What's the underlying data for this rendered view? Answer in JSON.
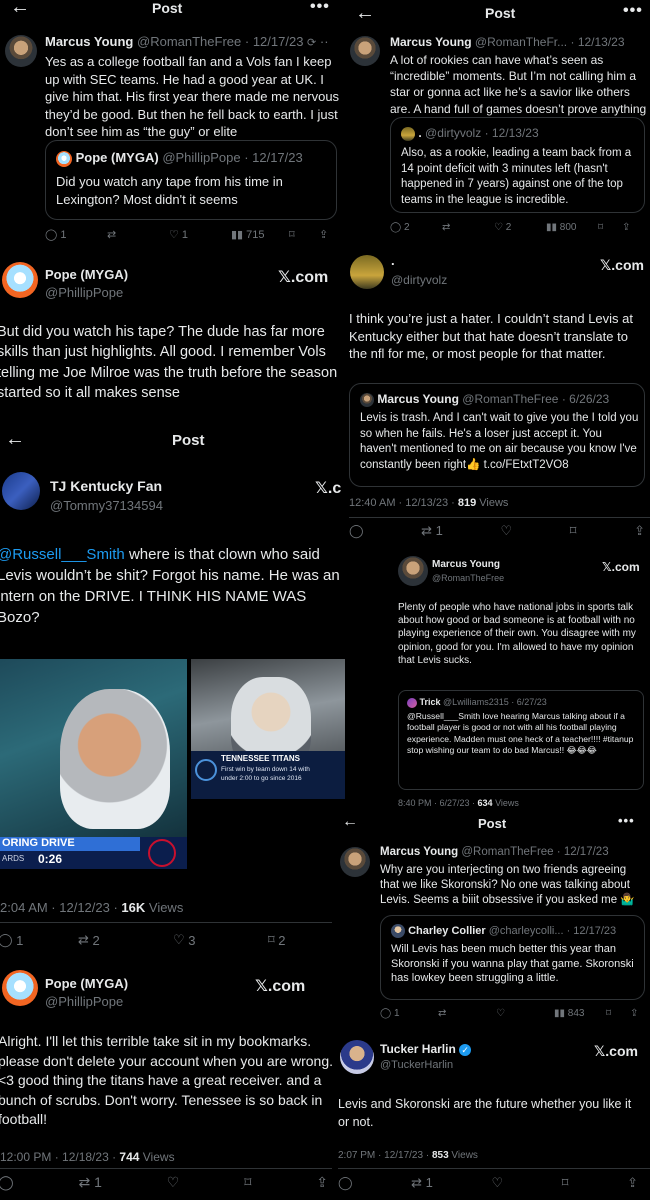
{
  "p1": {
    "header": {
      "back": "←",
      "title": "Post",
      "more": "•••"
    },
    "author": "Marcus Young",
    "handle": "@RomanTheFree",
    "date": "· 12/17/23",
    "body": "Yes as a college football fan and a Vols fan I keep up with SEC teams. He had a good year at UK. I give him that. His first year there made me nervous they’d be good. But then he fell back to earth. I just don’t see him as “the guy” or elite",
    "quote": {
      "author": "Pope (MYGA)",
      "handle": "@PhillipPope",
      "date": "· 12/17/23",
      "body": "Did you watch any tape from his time in Lexington? Most didn't it seems"
    },
    "actions": {
      "reply": "1",
      "retweet": "",
      "like": "1",
      "views": "715"
    }
  },
  "p2": {
    "header": {
      "back": "←",
      "title": "Post",
      "more": "•••"
    },
    "author": "Marcus Young",
    "handle": "@RomanTheFr...",
    "date": "· 12/13/23",
    "body": "A lot of rookies can have what’s seen as “incredible” moments. But I’m not calling him a star or gonna act like he’s a savior like others are. A hand full of games doesn’t prove anything",
    "quote": {
      "author": ".",
      "handle": "@dirtyvolz",
      "date": "· 12/13/23",
      "body": "Also, as a rookie, leading a team back from a 14 point deficit with 3 minutes left (hasn't happened in 7 years) against one of the top teams in the league is incredible."
    },
    "actions": {
      "reply": "2",
      "retweet": "",
      "like": "2",
      "views": "800"
    }
  },
  "p3": {
    "author": "Pope (MYGA)",
    "handle": "@PhillipPope",
    "xlogo": "𝕏.com",
    "body": "But did you watch his tape? The dude has far more skills than just highlights. All good. I remember Vols telling me Joe Milroe was the truth before the season started so it all makes sense"
  },
  "p4": {
    "author": ".",
    "handle": "@dirtyvolz",
    "xlogo": "𝕏.com",
    "body": "I think you’re just a hater. I couldn’t stand Levis at Kentucky either but that hate doesn’t translate to the nfl for me, or most people for that matter.",
    "quote": {
      "author": "Marcus Young",
      "handle": "@RomanTheFree",
      "date": "· 6/26/23",
      "body": "Levis is trash. And I can't wait to give you the I told you so when he fails. He's a loser just accept it. You haven't mentioned to me on air because you know I've constantly been right👍 ",
      "link": "t.co/FEtxtT2VO8"
    },
    "time": "12:40 AM · 12/13/23 · ",
    "views": "819",
    "views_label": " Views"
  },
  "p5": {
    "header": {
      "back": "←",
      "title": "Post"
    },
    "author": "TJ Kentucky Fan",
    "handle": "@Tommy37134594",
    "xlogo": "𝕏.c",
    "mention": "@Russell___Smith",
    "body": " where is that clown who said Levis wouldn’t be shit? Forgot his name. He was an intern on the DRIVE. I THINK HIS NAME WAS Bozo?",
    "photo1": {
      "scorebug": "ORING DRIVE",
      "yards": "ARDS",
      "clock": "0:26",
      "logo_text": "TITANS"
    },
    "photo2": {
      "banner_title": "TENNESSEE TITANS",
      "banner_line1": "First win by team down 14 with",
      "banner_line2": "under 2:00 to go since 2016"
    },
    "time": "2:04 AM · 12/12/23 · ",
    "views": "16K",
    "views_label": " Views",
    "actions": {
      "reply": "1",
      "retweet": "2",
      "like": "3",
      "bookmark": "2"
    }
  },
  "p6": {
    "author": "Marcus Young",
    "handle": "@RomanTheFree",
    "xlogo": "𝕏.com",
    "body": "Plenty of people who have national jobs in sports talk about how good or bad someone is at football with no playing experience of their own. You disagree with my opinion, good for you. I'm allowed to have my opinion that Levis sucks.",
    "quote": {
      "author": "Trick",
      "handle": "@Lwilliams2315 · 6/27/23",
      "mention": "@Russell___Smith",
      "body": " love hearing Marcus talking about if a  football player is good or not with all his football playing experience.  Madden must one heck of a teacher!!!! #titanup stop wishing our team to do bad Marcus!! 😂😂😂"
    },
    "time": "8:40 PM · 6/27/23 · ",
    "views": "634",
    "views_label": " Views"
  },
  "p7": {
    "author": "Pope (MYGA)",
    "handle": "@PhillipPope",
    "xlogo": "𝕏.com",
    "body": "Alright. I'll let this terrible take sit in my bookmarks. please don't delete your account when you are wrong. <3 good thing the titans have a great receiver. and a bunch of scrubs. Don't worry. Tenessee is so back in football!",
    "time": "12:00 PM · 12/18/23 · ",
    "views": "744",
    "views_label": " Views"
  },
  "p8": {
    "header": {
      "back": "←",
      "title": "Post",
      "more": "•••"
    },
    "author": "Marcus Young",
    "handle": "@RomanTheFree",
    "date": "· 12/17/23",
    "body": "Why are you interjecting on two friends agreeing that we like Skoronski? No one was talking about Levis. Seems a biiit obsessive if you asked me 🤷‍♂️",
    "quote": {
      "author": "Charley Collier",
      "handle": "@charleycolli...",
      "date": "· 12/17/23",
      "body": "Will Levis has been much better this year than Skoronski if you wanna play that game. Skoronski has lowkey been struggling a little."
    },
    "actions": {
      "reply": "1",
      "retweet": "",
      "like": "",
      "views": "843"
    },
    "reply": {
      "author": "Tucker Harlin",
      "handle": "@TuckerHarlin",
      "xlogo": "𝕏.com",
      "body": "Levis and Skoronski are the future whether you like it or not.",
      "time": "2:07 PM · 12/17/23 · ",
      "views": "853",
      "views_label": " Views"
    }
  }
}
